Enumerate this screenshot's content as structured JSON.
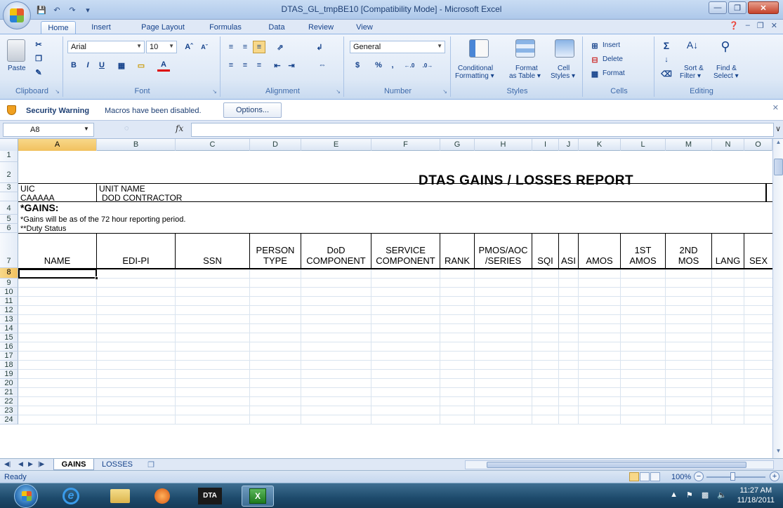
{
  "window": {
    "title": "DTAS_GL_tmpBE10  [Compatibility Mode]  -  Microsoft Excel",
    "controls": [
      "minimize",
      "maximize",
      "close"
    ]
  },
  "ribbon_tabs": [
    "Home",
    "Insert",
    "Page Layout",
    "Formulas",
    "Data",
    "Review",
    "View"
  ],
  "ribbon": {
    "clipboard": {
      "label": "Clipboard",
      "paste": "Paste"
    },
    "font": {
      "label": "Font",
      "font_name": "Arial",
      "font_size": "10"
    },
    "alignment": {
      "label": "Alignment"
    },
    "number": {
      "label": "Number",
      "format": "General",
      "currency": "$",
      "percent": "%",
      "comma": ","
    },
    "styles": {
      "label": "Styles",
      "conditional": "Conditional",
      "conditional2": "Formatting ▾",
      "format_as": "Format",
      "format_as2": "as Table ▾",
      "cell": "Cell",
      "cell2": "Styles ▾"
    },
    "cells": {
      "label": "Cells",
      "insert": "Insert",
      "delete": "Delete",
      "format": "Format"
    },
    "editing": {
      "label": "Editing",
      "sort": "Sort &",
      "sort2": "Filter ▾",
      "find": "Find &",
      "find2": "Select ▾"
    }
  },
  "security": {
    "title": "Security Warning",
    "message": "Macros have been disabled.",
    "button": "Options..."
  },
  "formula_bar": {
    "name_box": "A8",
    "fx": "fx",
    "formula": ""
  },
  "columns": [
    "A",
    "B",
    "C",
    "D",
    "E",
    "F",
    "G",
    "H",
    "I",
    "J",
    "K",
    "L",
    "M",
    "N",
    "O"
  ],
  "selected_column": "A",
  "rows": [
    "1",
    "2",
    "3",
    "4",
    "5",
    "6",
    "7",
    "8",
    "9",
    "10",
    "11",
    "12",
    "13",
    "14",
    "15",
    "16",
    "17",
    "18",
    "19",
    "20",
    "21",
    "22",
    "23",
    "24"
  ],
  "selected_row": "8",
  "sheet": {
    "report_title": "DTAS GAINS / LOSSES REPORT",
    "uic_label": "UIC",
    "unit_name_label": "UNIT NAME",
    "uic_value": "CAAAAA",
    "unit_name_value": "DOD CONTRACTOR",
    "gains_heading": "*GAINS:",
    "note1": "*Gains will be as of the 72 hour reporting period.",
    "note2": "**Duty Status",
    "headers": [
      {
        "line1": "NAME",
        "line2": ""
      },
      {
        "line1": "EDI-PI",
        "line2": ""
      },
      {
        "line1": "SSN",
        "line2": ""
      },
      {
        "line1": "PERSON",
        "line2": "TYPE"
      },
      {
        "line1": "DoD",
        "line2": "COMPONENT"
      },
      {
        "line1": "SERVICE",
        "line2": "COMPONENT"
      },
      {
        "line1": "RANK",
        "line2": ""
      },
      {
        "line1": "PMOS/AOC",
        "line2": "/SERIES"
      },
      {
        "line1": "SQI",
        "line2": ""
      },
      {
        "line1": "ASI",
        "line2": ""
      },
      {
        "line1": "AMOS",
        "line2": ""
      },
      {
        "line1": "1ST",
        "line2": "AMOS"
      },
      {
        "line1": "2ND",
        "line2": "MOS"
      },
      {
        "line1": "LANG",
        "line2": ""
      },
      {
        "line1": "SEX",
        "line2": ""
      }
    ]
  },
  "sheet_tabs": [
    {
      "label": "GAINS",
      "active": true
    },
    {
      "label": "LOSSES",
      "active": false
    }
  ],
  "status": {
    "text": "Ready",
    "zoom": "100%"
  },
  "taskbar": {
    "apps": [
      "internet-explorer",
      "file-explorer",
      "media-player",
      "dtas",
      "excel"
    ],
    "dtas_label": "DTA",
    "time": "11:27 AM",
    "date": "11/18/2011"
  }
}
